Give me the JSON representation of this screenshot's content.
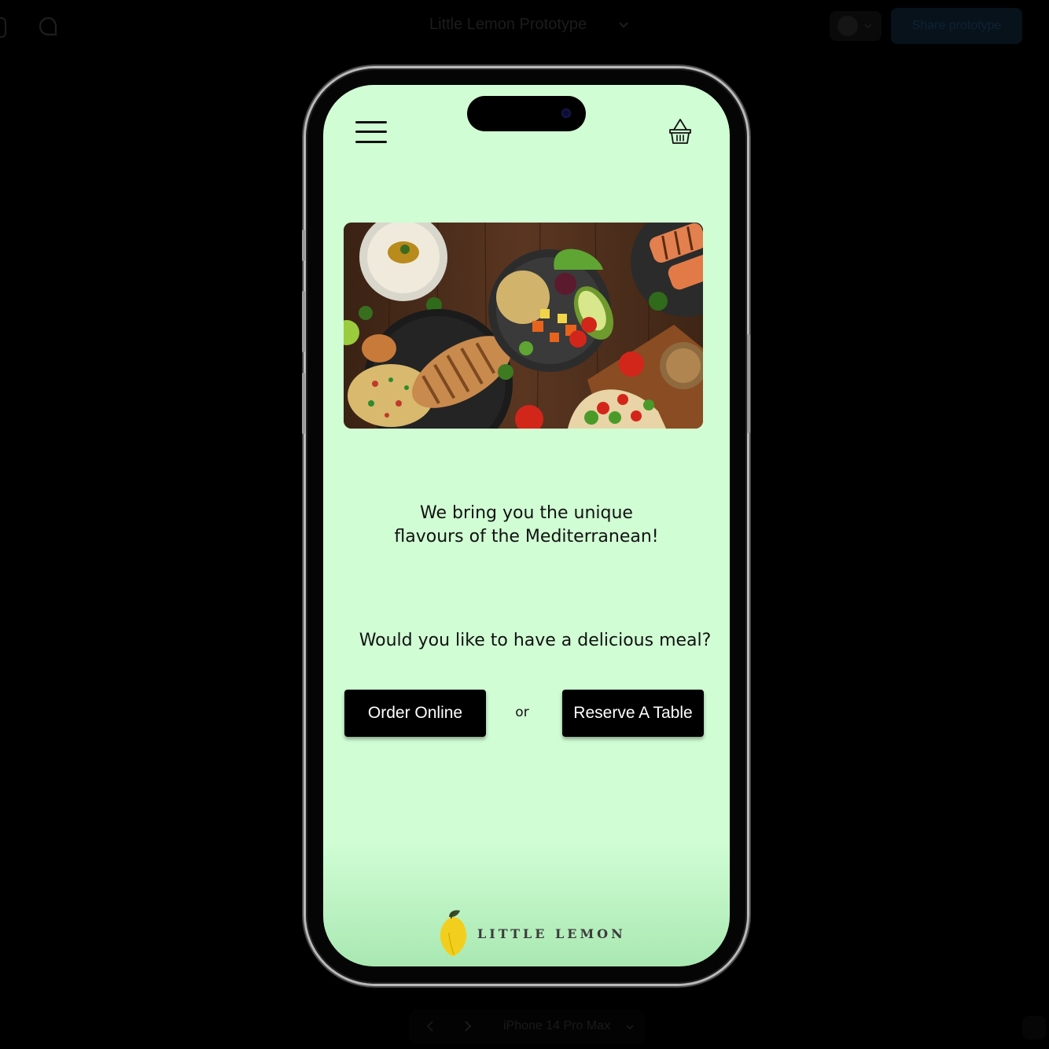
{
  "toolbar": {
    "prototype_title": "Little Lemon Prototype",
    "share_label": "Share prototype"
  },
  "device_bar": {
    "device_label": "iPhone 14 Pro Max"
  },
  "app": {
    "tagline_line1": "We bring you the unique",
    "tagline_line2": "flavours of the Mediterranean!",
    "question": "Would you like to have a delicious meal?",
    "order_button": "Order Online",
    "or_text": "or",
    "reserve_button": "Reserve A Table",
    "logo_text": "LITTLE LEMON",
    "hero_image_subject": "mediterranean food spread on wooden table",
    "icons": [
      "hamburger-menu-icon",
      "basket-icon",
      "lemon-logo-icon"
    ]
  },
  "colors": {
    "screen_bg": "#d0fdd4",
    "screen_bottom": "#a9e8b2",
    "button_bg": "#000000",
    "button_text": "#ffffff"
  }
}
